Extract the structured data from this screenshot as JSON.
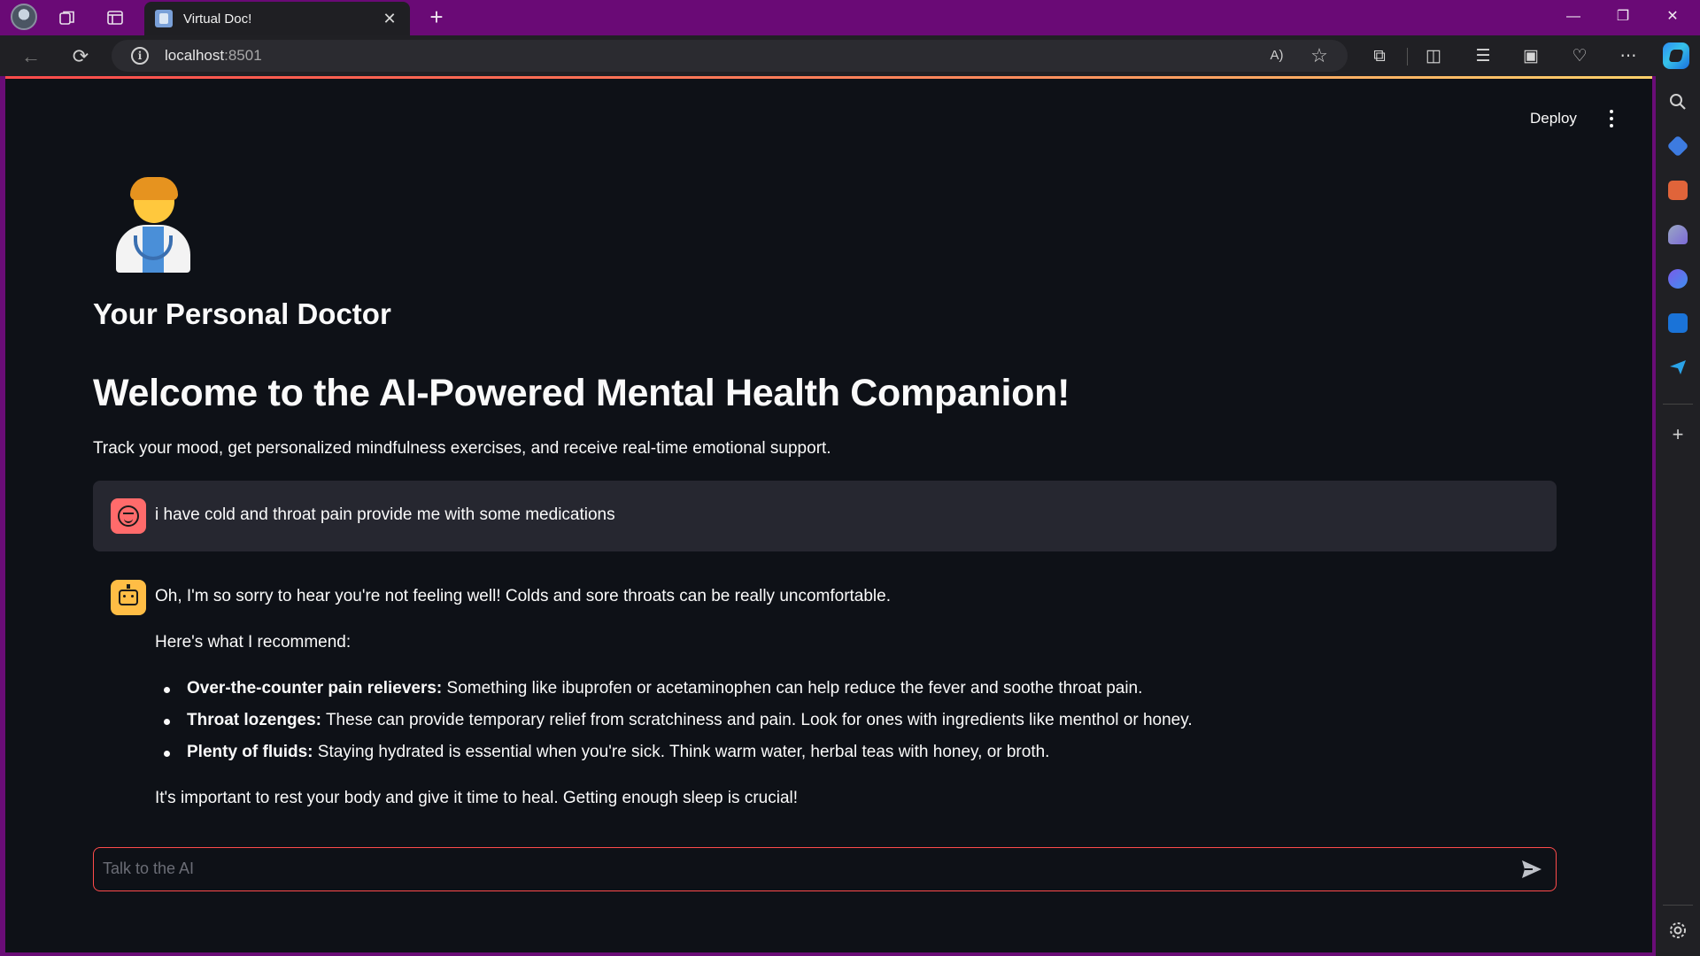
{
  "browser": {
    "tab_title": "Virtual Doc!",
    "tab_close": "✕",
    "new_tab": "+",
    "url_host": "localhost",
    "url_port": ":8501",
    "window_controls": {
      "minimize": "—",
      "restore": "❐",
      "close": "✕"
    },
    "icons": {
      "back": "←",
      "refresh": "⟳",
      "read_aloud": "A)",
      "favorite": "☆",
      "extensions": "⧉",
      "split": "◫",
      "favorites_bar": "☰",
      "collections": "▣",
      "health": "♡",
      "more": "⋯"
    }
  },
  "app": {
    "deploy_label": "Deploy",
    "subtitle": "Your Personal Doctor",
    "heading": "Welcome to the AI-Powered Mental Health Companion!",
    "intro": "Track your mood, get personalized mindfulness exercises, and receive real-time emotional support."
  },
  "chat": {
    "user_message": "i have cold and throat pain provide me with some medications",
    "assistant": {
      "opening": "Oh, I'm so sorry to hear you're not feeling well! Colds and sore throats can be really uncomfortable.",
      "lead_in": "Here's what I recommend:",
      "items": [
        {
          "title": "Over-the-counter pain relievers:",
          "text": " Something like ibuprofen or acetaminophen can help reduce the fever and soothe throat pain."
        },
        {
          "title": "Throat lozenges:",
          "text": " These can provide temporary relief from scratchiness and pain. Look for ones with ingredients like menthol or honey."
        },
        {
          "title": "Plenty of fluids:",
          "text": " Staying hydrated is essential when you're sick. Think warm water, herbal teas with honey, or broth."
        }
      ],
      "closing": "It's important to rest your body and give it time to heal. Getting enough sleep is crucial!"
    },
    "input_placeholder": "Talk to the AI"
  },
  "colors": {
    "page_bg": "#0e1117",
    "accent": "#ff4b4b",
    "user_avatar": "#ff6b6b",
    "assistant_avatar": "#ffbd45",
    "browser_frame": "#6a0a76"
  }
}
